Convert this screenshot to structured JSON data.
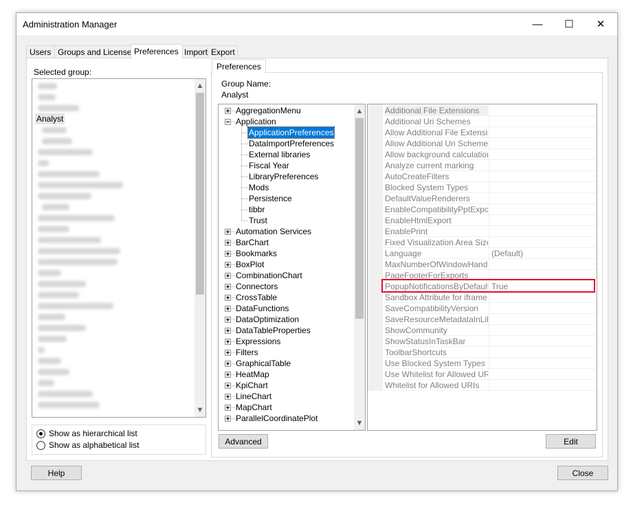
{
  "window": {
    "title": "Administration Manager"
  },
  "title_buttons": {
    "minimize": "—",
    "maximize": "☐",
    "close": "✕"
  },
  "tabs": [
    {
      "label": "Users"
    },
    {
      "label": "Groups and Licenses"
    },
    {
      "label": "Preferences",
      "active": true
    },
    {
      "label": "Import"
    },
    {
      "label": "Export"
    }
  ],
  "left": {
    "selected_group_label": "Selected group:",
    "visible_group": "Analyst",
    "radio_hier": "Show as hierarchical list",
    "radio_alpha": "Show as alphabetical list",
    "radio_selected": "hierarchical"
  },
  "inner_tab": {
    "label": "Preferences"
  },
  "group_name": {
    "label": "Group Name:",
    "value": "Analyst"
  },
  "tree": {
    "items": [
      {
        "label": "AggregationMenu",
        "level": 0,
        "expander": "plus"
      },
      {
        "label": "Application",
        "level": 0,
        "expander": "minus"
      },
      {
        "label": "ApplicationPreferences",
        "level": 1,
        "selected": true
      },
      {
        "label": "DataImportPreferences",
        "level": 1
      },
      {
        "label": "External libraries",
        "level": 1
      },
      {
        "label": "Fiscal Year",
        "level": 1
      },
      {
        "label": "LibraryPreferences",
        "level": 1
      },
      {
        "label": "Mods",
        "level": 1
      },
      {
        "label": "Persistence",
        "level": 1
      },
      {
        "label": "tibbr",
        "level": 1
      },
      {
        "label": "Trust",
        "level": 1
      },
      {
        "label": "Automation Services",
        "level": 0,
        "expander": "plus"
      },
      {
        "label": "BarChart",
        "level": 0,
        "expander": "plus"
      },
      {
        "label": "Bookmarks",
        "level": 0,
        "expander": "plus"
      },
      {
        "label": "BoxPlot",
        "level": 0,
        "expander": "plus"
      },
      {
        "label": "CombinationChart",
        "level": 0,
        "expander": "plus"
      },
      {
        "label": "Connectors",
        "level": 0,
        "expander": "plus"
      },
      {
        "label": "CrossTable",
        "level": 0,
        "expander": "plus"
      },
      {
        "label": "DataFunctions",
        "level": 0,
        "expander": "plus"
      },
      {
        "label": "DataOptimization",
        "level": 0,
        "expander": "plus"
      },
      {
        "label": "DataTableProperties",
        "level": 0,
        "expander": "plus"
      },
      {
        "label": "Expressions",
        "level": 0,
        "expander": "plus"
      },
      {
        "label": "Filters",
        "level": 0,
        "expander": "plus"
      },
      {
        "label": "GraphicalTable",
        "level": 0,
        "expander": "plus"
      },
      {
        "label": "HeatMap",
        "level": 0,
        "expander": "plus"
      },
      {
        "label": "KpiChart",
        "level": 0,
        "expander": "plus"
      },
      {
        "label": "LineChart",
        "level": 0,
        "expander": "plus"
      },
      {
        "label": "MapChart",
        "level": 0,
        "expander": "plus"
      },
      {
        "label": "ParallelCoordinatePlot",
        "level": 0,
        "expander": "plus"
      }
    ]
  },
  "grid": {
    "rows": [
      {
        "name": "Additional File Extensions",
        "value": ""
      },
      {
        "name": "Additional Uri Schemes",
        "value": ""
      },
      {
        "name": "Allow Additional File Extensions",
        "value": ""
      },
      {
        "name": "Allow Additional Uri Schemes",
        "value": ""
      },
      {
        "name": "Allow background calculations f",
        "value": ""
      },
      {
        "name": "Analyze current marking",
        "value": ""
      },
      {
        "name": "AutoCreateFilters",
        "value": ""
      },
      {
        "name": "Blocked System Types",
        "value": ""
      },
      {
        "name": "DefaultValueRenderers",
        "value": ""
      },
      {
        "name": "EnableCompatibilityPptExport",
        "value": ""
      },
      {
        "name": "EnableHtmlExport",
        "value": ""
      },
      {
        "name": "EnablePrint",
        "value": ""
      },
      {
        "name": "Fixed Visualization Area Sizes",
        "value": ""
      },
      {
        "name": "Language",
        "value": "(Default)"
      },
      {
        "name": "MaxNumberOfWindowHandles",
        "value": ""
      },
      {
        "name": "PageFooterForExports",
        "value": ""
      },
      {
        "name": "PopupNotificationsByDefault",
        "value": "True",
        "highlighted": true
      },
      {
        "name": "Sandbox Attribute for iframe Cor",
        "value": ""
      },
      {
        "name": "SaveCompatibilityVersion",
        "value": ""
      },
      {
        "name": "SaveResourceMetadataInLibrar",
        "value": ""
      },
      {
        "name": "ShowCommunity",
        "value": ""
      },
      {
        "name": "ShowStatusInTaskBar",
        "value": ""
      },
      {
        "name": "ToolbarShortcuts",
        "value": ""
      },
      {
        "name": "Use Blocked System Types",
        "value": ""
      },
      {
        "name": "Use Whitelist for Allowed URIs",
        "value": ""
      },
      {
        "name": "Whitelist for Allowed URIs",
        "value": ""
      }
    ]
  },
  "buttons": {
    "advanced": "Advanced",
    "edit": "Edit",
    "help": "Help",
    "close": "Close"
  },
  "colors": {
    "highlight": "#e0102f",
    "selection": "#0078d7"
  }
}
